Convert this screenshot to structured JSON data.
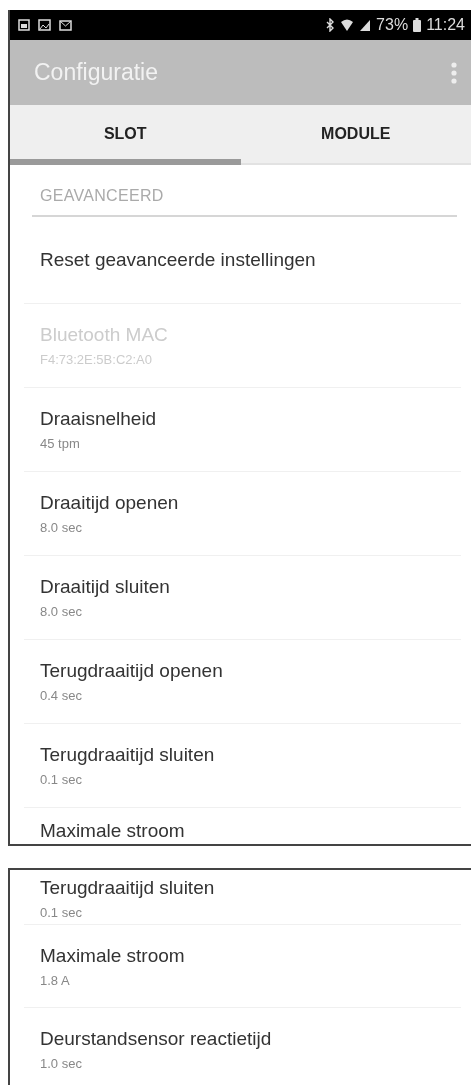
{
  "status_bar": {
    "battery": "73%",
    "time": "11:24"
  },
  "app_bar": {
    "title": "Configuratie"
  },
  "tabs": [
    {
      "label": "SLOT",
      "selected": true
    },
    {
      "label": "MODULE",
      "selected": false
    }
  ],
  "panels": [
    {
      "section_header": "GEAVANCEERD",
      "items": [
        {
          "title": "Reset geavanceerde instellingen",
          "disabled": false
        },
        {
          "title": "Bluetooth MAC",
          "summary": "F4:73:2E:5B:C2:A0",
          "disabled": true
        },
        {
          "title": "Draaisnelheid",
          "summary": "45 tpm",
          "disabled": false
        },
        {
          "title": "Draaitijd openen",
          "summary": "8.0 sec",
          "disabled": false
        },
        {
          "title": "Draaitijd sluiten",
          "summary": "8.0 sec",
          "disabled": false
        },
        {
          "title": "Terugdraaitijd openen",
          "summary": "0.4 sec",
          "disabled": false
        },
        {
          "title": "Terugdraaitijd sluiten",
          "summary": "0.1 sec",
          "disabled": false
        },
        {
          "title": "Maximale stroom",
          "disabled": false
        }
      ]
    },
    {
      "items": [
        {
          "title": "Terugdraaitijd sluiten",
          "summary": "0.1 sec",
          "disabled": false
        },
        {
          "title": "Maximale stroom",
          "summary": "1.8 A",
          "disabled": false
        },
        {
          "title": "Deurstandsensor reactietijd",
          "summary": "1.0 sec",
          "disabled": false
        }
      ]
    }
  ]
}
